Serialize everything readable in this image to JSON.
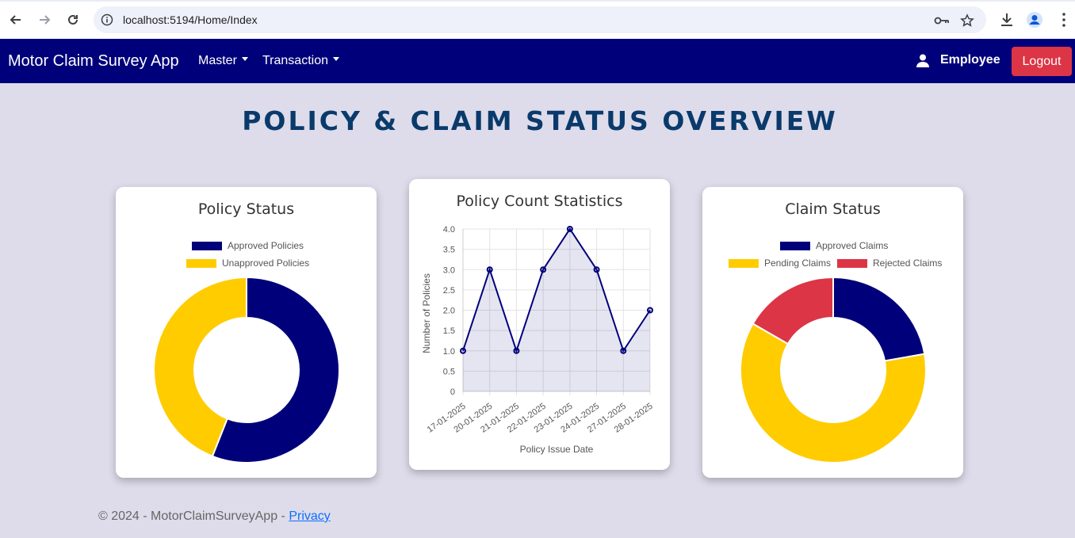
{
  "browser": {
    "url": "localhost:5194/Home/Index",
    "icons": [
      "back-icon",
      "forward-icon",
      "reload-icon",
      "site-info-icon",
      "password-key-icon",
      "bookmark-star-icon",
      "download-icon",
      "profile-icon",
      "more-menu-icon"
    ]
  },
  "navbar": {
    "brand": "Motor Claim Survey App",
    "menus": [
      {
        "label": "Master"
      },
      {
        "label": "Transaction"
      }
    ],
    "user_label": "Employee",
    "logout_label": "Logout"
  },
  "page": {
    "title": "POLICY & CLAIM STATUS OVERVIEW"
  },
  "colors": {
    "navy": "#00007a",
    "yellow": "#ffcc00",
    "red": "#dc3545",
    "title": "#0a3a6b",
    "background": "#dedcea"
  },
  "chart_data": [
    {
      "type": "pie",
      "variant": "doughnut",
      "title": "Policy Status",
      "labels": [
        "Approved Policies",
        "Unapproved Policies"
      ],
      "values": [
        14,
        11
      ],
      "colors": [
        "#00007a",
        "#ffcc00"
      ],
      "legend": "top"
    },
    {
      "type": "line",
      "title": "Policy Count Statistics",
      "xlabel": "Policy Issue Date",
      "ylabel": "Number of Policies",
      "x": [
        "17-01-2025",
        "20-01-2025",
        "21-01-2025",
        "22-01-2025",
        "23-01-2025",
        "24-01-2025",
        "27-01-2025",
        "28-01-2025"
      ],
      "y": [
        1,
        3,
        1,
        3,
        4,
        3,
        1,
        2
      ],
      "ylim": [
        0,
        4
      ],
      "yticks": [
        "0",
        "0.5",
        "1.0",
        "1.5",
        "2.0",
        "2.5",
        "3.0",
        "3.5",
        "4.0"
      ],
      "grid": true,
      "fill": true,
      "color": "#00007a"
    },
    {
      "type": "pie",
      "variant": "doughnut",
      "title": "Claim Status",
      "labels": [
        "Approved Claims",
        "Pending Claims",
        "Rejected Claims"
      ],
      "values": [
        4,
        11,
        3
      ],
      "colors": [
        "#00007a",
        "#ffcc00",
        "#dc3545"
      ],
      "legend": "top"
    }
  ],
  "footer": {
    "text": "© 2024 - MotorClaimSurveyApp - ",
    "link": "Privacy"
  }
}
